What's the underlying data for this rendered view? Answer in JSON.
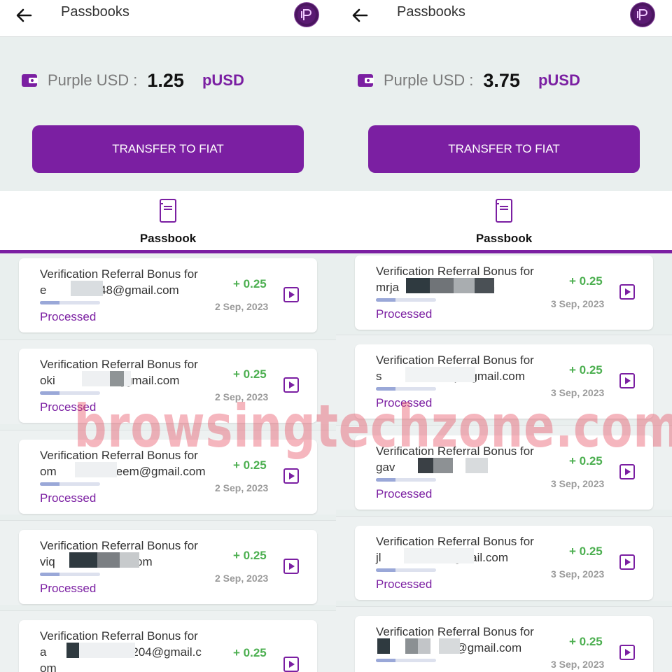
{
  "panels": [
    {
      "header": {
        "title": "Passbooks",
        "avatar_icon": "purple-logo-icon"
      },
      "wallet": {
        "label": "Purple USD :",
        "value": "1.25",
        "unit": "pUSD"
      },
      "transfer_button": "TRANSFER TO FIAT",
      "tab": {
        "label": "Passbook",
        "icon": "passbook-icon"
      },
      "transactions": [
        {
          "title": "Verification Referral Bonus for",
          "email": "e        48@gmail.com",
          "email2": "",
          "amount": "+ 0.25",
          "date": "2 Sep, 2023",
          "status": "Processed",
          "progress": 0.33
        },
        {
          "title": "Verification Referral Bonus for",
          "email": "oki          )gmail.com",
          "email2": "",
          "amount": "+ 0.25",
          "date": "2 Sep, 2023",
          "status": "Processed",
          "progress": 0.33
        },
        {
          "title": "Verification Referral Bonus for",
          "email": "om         eem@gmail.com",
          "email2": "",
          "amount": "+ 0.25",
          "date": "2 Sep, 2023",
          "status": "Processed",
          "progress": 0.33
        },
        {
          "title": "Verification Referral Bonus for",
          "email": "viq          il.com",
          "email2": "",
          "amount": "+ 0.25",
          "date": "2 Sep, 2023",
          "status": "Processed",
          "progress": 0.33
        },
        {
          "title": "Verification Referral Bonus for",
          "email": "a          im1204@gmail.c",
          "email2": "om",
          "amount": "+ 0.25",
          "date": "",
          "status": "",
          "progress": 0.33
        }
      ]
    },
    {
      "header": {
        "title": "Passbooks",
        "avatar_icon": "purple-logo-icon"
      },
      "wallet": {
        "label": "Purple USD :",
        "value": "3.75",
        "unit": "pUSD"
      },
      "transfer_button": "TRANSFER TO FIAT",
      "tab": {
        "label": "Passbook",
        "icon": "passbook-icon"
      },
      "transactions": [
        {
          "title": "Verification Referral Bonus for",
          "email": "mrja            om",
          "email2": "",
          "amount": "+ 0.25",
          "date": "3 Sep, 2023",
          "status": "Processed",
          "progress": 0.33
        },
        {
          "title": "Verification Referral Bonus for",
          "email": "s           )@gmail.com",
          "email2": "",
          "amount": "+ 0.25",
          "date": "3 Sep, 2023",
          "status": "Processed",
          "progress": 0.33
        },
        {
          "title": "Verification Referral Bonus for",
          "email": "gav           m",
          "email2": "",
          "amount": "+ 0.25",
          "date": "3 Sep, 2023",
          "status": "Processed",
          "progress": 0.33
        },
        {
          "title": "Verification Referral Bonus for",
          "email": "jl           gmail.com",
          "email2": "",
          "amount": "+ 0.25",
          "date": "3 Sep, 2023",
          "status": "Processed",
          "progress": 0.33
        },
        {
          "title": "Verification Referral Bonus for",
          "email": "           2@gmail.com",
          "email2": "",
          "amount": "+ 0.25",
          "date": "3 Sep, 2023",
          "status": "",
          "progress": 0.33
        }
      ]
    }
  ],
  "watermark": "browsingtechzone.com",
  "colors": {
    "accent": "#7b1fa2",
    "amount_green": "#4caf50",
    "page_bg": "#e9efee"
  }
}
